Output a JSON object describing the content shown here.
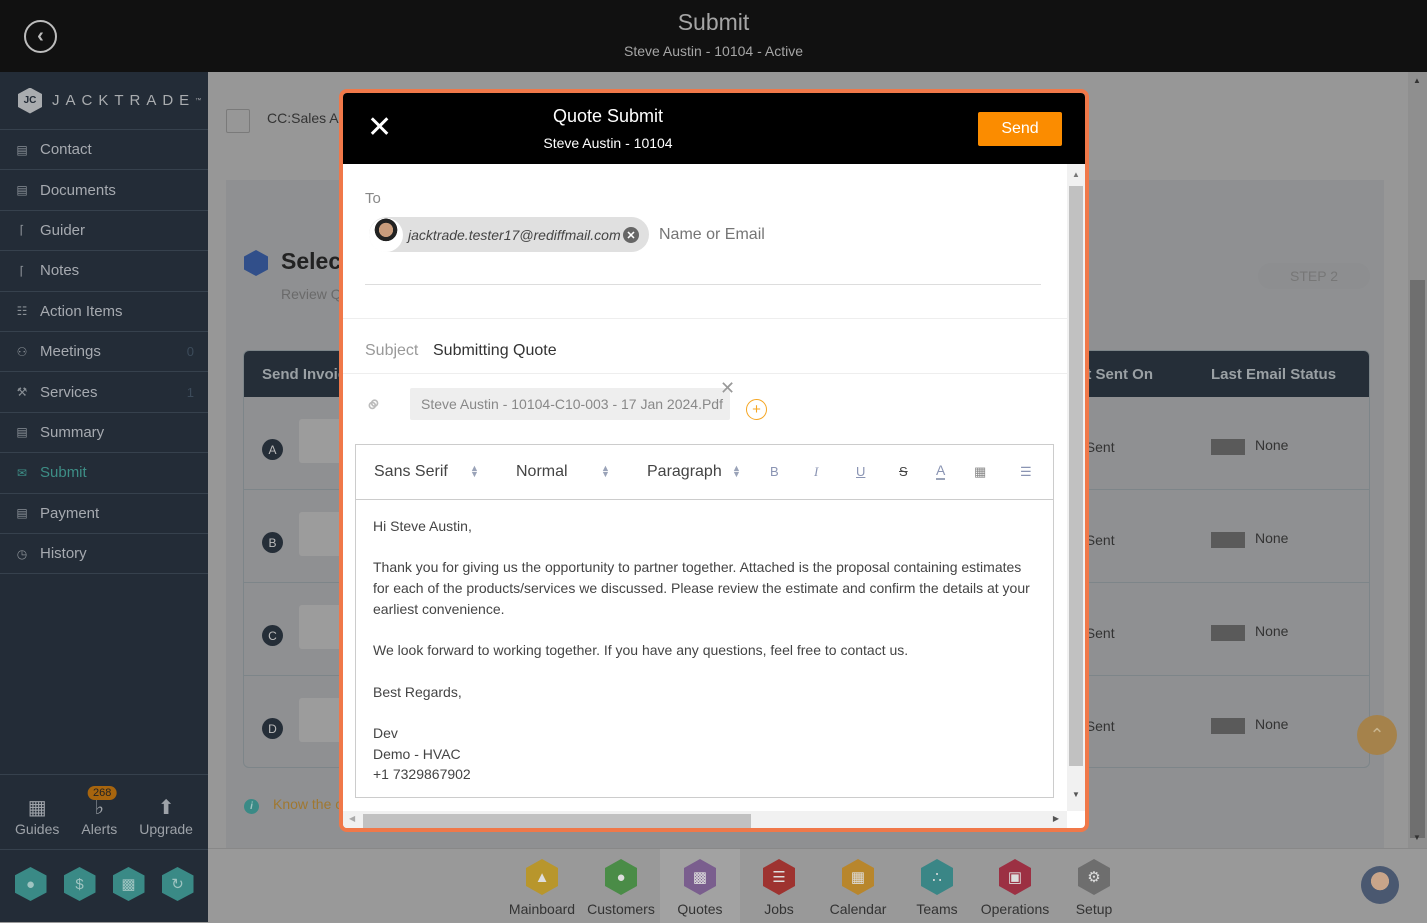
{
  "topbar": {
    "title": "Submit",
    "subtitle": "Steve Austin - 10104 - Active",
    "back_icon": "back-arrow-circle-icon"
  },
  "sidebar": {
    "logo": "JACKTRADE",
    "logo_tm": "™",
    "items": [
      {
        "label": "Contact",
        "icon": "contact-book-icon",
        "count": ""
      },
      {
        "label": "Documents",
        "icon": "documents-icon",
        "count": ""
      },
      {
        "label": "Guider",
        "icon": "signpost-icon",
        "count": ""
      },
      {
        "label": "Notes",
        "icon": "signpost-icon",
        "count": ""
      },
      {
        "label": "Action Items",
        "icon": "clipboard-icon",
        "count": ""
      },
      {
        "label": "Meetings",
        "icon": "meeting-icon",
        "count": "0"
      },
      {
        "label": "Services",
        "icon": "services-icon",
        "count": "1"
      },
      {
        "label": "Summary",
        "icon": "summary-icon",
        "count": ""
      },
      {
        "label": "Submit",
        "icon": "submit-mail-icon",
        "count": "",
        "active": true
      },
      {
        "label": "Payment",
        "icon": "payment-icon",
        "count": ""
      },
      {
        "label": "History",
        "icon": "history-icon",
        "count": ""
      }
    ],
    "bottom": [
      {
        "label": "Guides",
        "icon": "book-icon"
      },
      {
        "label": "Alerts",
        "icon": "bell-icon",
        "badge": "268"
      },
      {
        "label": "Upgrade",
        "icon": "arrow-up-icon"
      }
    ],
    "quick_actions": [
      "user-icon",
      "dollar-icon",
      "money-icon",
      "workflow-icon"
    ]
  },
  "background": {
    "cc_label": "CC:Sales Ag",
    "section_title": "Selec",
    "section_sub": "Review Q",
    "step": "STEP 2",
    "table": {
      "headers": [
        "Send Invoic",
        "st Sent On",
        "Last Email Status"
      ],
      "rows": [
        {
          "letter": "A",
          "sent": "t Sent",
          "status": "None"
        },
        {
          "letter": "B",
          "sent": "t Sent",
          "status": "None"
        },
        {
          "letter": "C",
          "sent": "t Sent",
          "status": "None"
        },
        {
          "letter": "D",
          "sent": "t Sent",
          "status": "None"
        }
      ]
    },
    "know_text": "Know the c"
  },
  "dock": [
    {
      "label": "Mainboard",
      "color": "#b8962c",
      "icon": "mainboard-icon"
    },
    {
      "label": "Customers",
      "color": "#4a8c47",
      "icon": "customer-icon"
    },
    {
      "label": "Quotes",
      "color": "#7a5e8e",
      "icon": "quotes-icon",
      "active": true
    },
    {
      "label": "Jobs",
      "color": "#9e3330",
      "icon": "jobs-list-icon"
    },
    {
      "label": "Calendar",
      "color": "#b8862c",
      "icon": "calendar-icon"
    },
    {
      "label": "Teams",
      "color": "#3a8686",
      "icon": "teams-icon"
    },
    {
      "label": "Operations",
      "color": "#9c3043",
      "icon": "briefcase-icon"
    },
    {
      "label": "Setup",
      "color": "#6e6e6e",
      "icon": "gear-icon"
    }
  ],
  "modal": {
    "title": "Quote Submit",
    "subtitle": "Steve Austin - 10104",
    "send_label": "Send",
    "to_label": "To",
    "recipient": "jacktrade.tester17@rediffmail.com",
    "to_placeholder": "Name or Email",
    "subject_label": "Subject",
    "subject_value": "Submitting Quote",
    "attachment": "Steve Austin - 10104-C10-003 - 17 Jan 2024.Pdf",
    "toolbar": {
      "font": "Sans Serif",
      "size": "Normal",
      "format": "Paragraph",
      "buttons": [
        "B",
        "I",
        "U",
        "S",
        "A"
      ]
    },
    "body": [
      "Hi Steve Austin,",
      "",
      "Thank you for giving us the opportunity to partner together. Attached is the proposal containing estimates for each of the products/services we discussed. Please review the estimate and confirm the details at your earliest convenience.",
      "",
      "We look forward to working together. If you have any questions, feel free to contact us.",
      "",
      "Best Regards,",
      "",
      "Dev",
      "Demo - HVAC",
      "+1 7329867902"
    ]
  }
}
